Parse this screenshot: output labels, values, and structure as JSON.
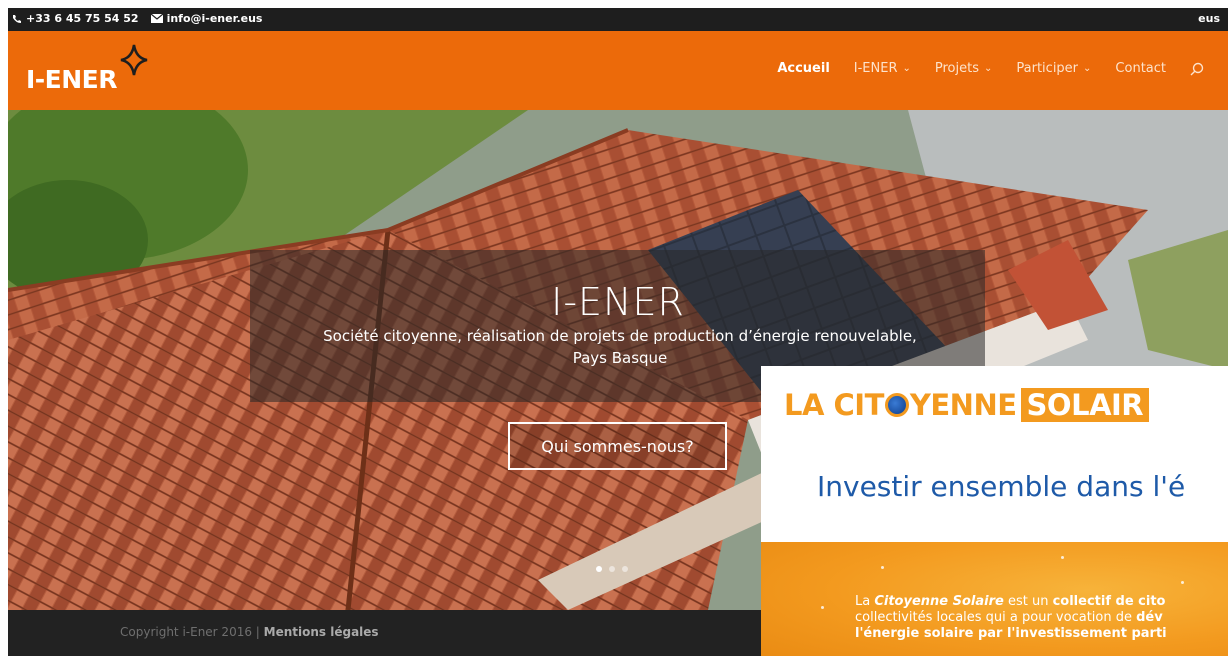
{
  "topbar": {
    "phone": "+33 6 45 75 54 52",
    "email": "info@i-ener.eus",
    "lang": "eus"
  },
  "header": {
    "logo_text": "I-ENER",
    "nav": [
      {
        "label": "Accueil",
        "active": true,
        "dropdown": false
      },
      {
        "label": "I-ENER",
        "active": false,
        "dropdown": true
      },
      {
        "label": "Projets",
        "active": false,
        "dropdown": true
      },
      {
        "label": "Participer",
        "active": false,
        "dropdown": true
      },
      {
        "label": "Contact",
        "active": false,
        "dropdown": false
      }
    ],
    "brand_color": "#ec6a0a"
  },
  "hero": {
    "title": "I-ENER",
    "subtitle_line1": "Société citoyenne, réalisation de projets de production d’énergie renouvelable,",
    "subtitle_line2": "Pays Basque",
    "button": "Qui sommes-nous?",
    "slides": 3,
    "active_slide": 1
  },
  "footer": {
    "copyright": "Copyright i-Ener 2016 | ",
    "legal": "Mentions légales"
  },
  "popup": {
    "brand_part1": "LA CIT",
    "brand_part1b": "YENNE",
    "brand_part2": "SOLAIR",
    "tagline": "Investir ensemble dans l'é",
    "line1_pre": "La ",
    "line1_em": "Citoyenne Solaire",
    "line1_mid": " est un ",
    "line1_bold": "collectif de cito",
    "line2_pre": "collectivités locales qui a pour vocation de ",
    "line2_bold": "dév",
    "line3": "l'énergie solaire par l'investissement parti",
    "accent": "#f39a1f",
    "blue": "#1e5aa8"
  }
}
